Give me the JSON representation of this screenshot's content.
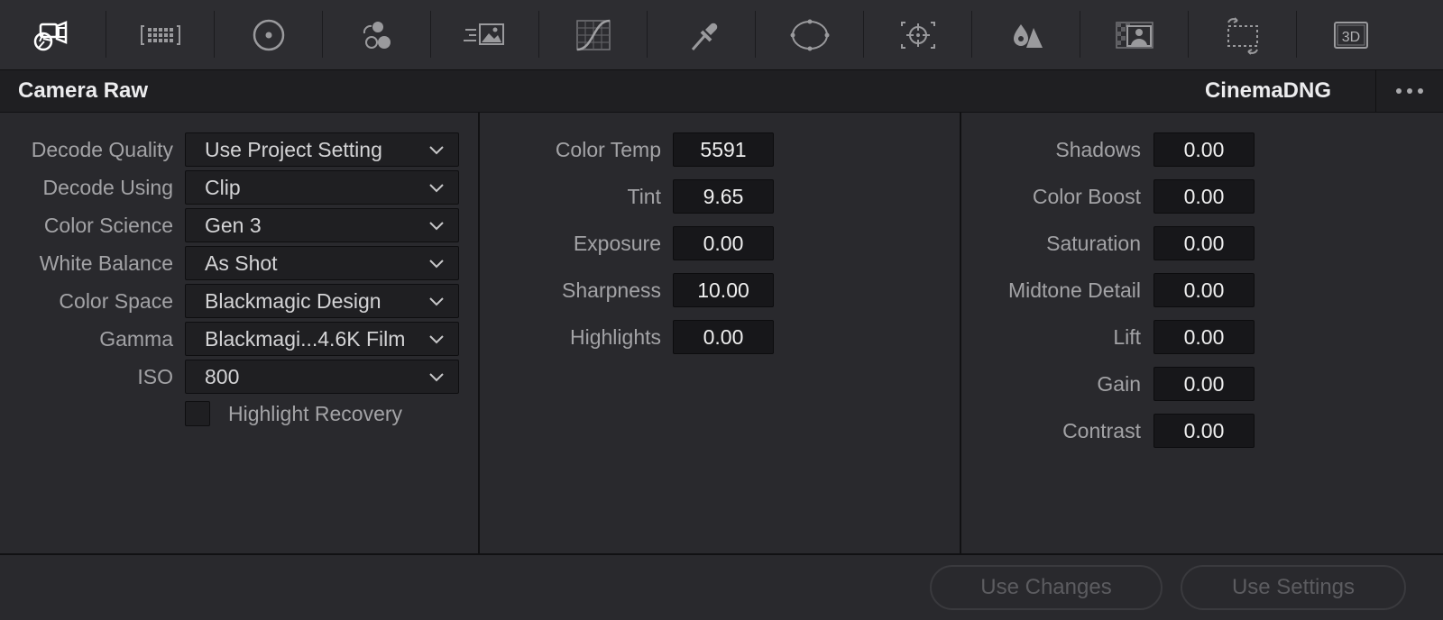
{
  "toolbar": {
    "tools": [
      {
        "icon": "camera-raw-icon",
        "active": true
      },
      {
        "icon": "color-match-icon"
      },
      {
        "icon": "color-wheels-icon"
      },
      {
        "icon": "hdr-palette-icon"
      },
      {
        "icon": "motion-effects-icon"
      },
      {
        "icon": "curves-icon"
      },
      {
        "icon": "qualifier-eyedropper-icon"
      },
      {
        "icon": "window-power-icon"
      },
      {
        "icon": "tracker-icon"
      },
      {
        "icon": "blur-icon"
      },
      {
        "icon": "key-icon"
      },
      {
        "icon": "sizing-icon"
      },
      {
        "icon": "3d-icon",
        "text": "3D"
      }
    ]
  },
  "header": {
    "title": "Camera Raw",
    "format": "CinemaDNG"
  },
  "decode": [
    {
      "label": "Decode Quality",
      "value": "Use Project Setting"
    },
    {
      "label": "Decode Using",
      "value": "Clip"
    },
    {
      "label": "Color Science",
      "value": "Gen 3"
    },
    {
      "label": "White Balance",
      "value": "As Shot"
    },
    {
      "label": "Color Space",
      "value": "Blackmagic Design"
    },
    {
      "label": "Gamma",
      "value": "Blackmagi...4.6K Film"
    },
    {
      "label": "ISO",
      "value": "800"
    }
  ],
  "highlight_recovery": {
    "label": "Highlight Recovery",
    "checked": false
  },
  "middle": [
    {
      "label": "Color Temp",
      "value": "5591"
    },
    {
      "label": "Tint",
      "value": "9.65"
    },
    {
      "label": "Exposure",
      "value": "0.00"
    },
    {
      "label": "Sharpness",
      "value": "10.00"
    },
    {
      "label": "Highlights",
      "value": "0.00"
    }
  ],
  "right": [
    {
      "label": "Shadows",
      "value": "0.00"
    },
    {
      "label": "Color Boost",
      "value": "0.00"
    },
    {
      "label": "Saturation",
      "value": "0.00"
    },
    {
      "label": "Midtone Detail",
      "value": "0.00"
    },
    {
      "label": "Lift",
      "value": "0.00"
    },
    {
      "label": "Gain",
      "value": "0.00"
    },
    {
      "label": "Contrast",
      "value": "0.00"
    }
  ],
  "buttons": {
    "use_changes": "Use Changes",
    "use_settings": "Use Settings"
  }
}
